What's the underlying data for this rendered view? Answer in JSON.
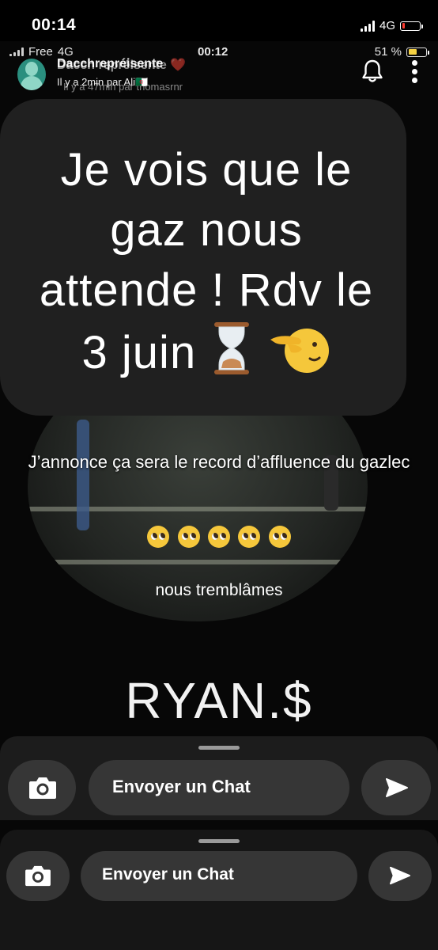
{
  "status": {
    "time": "00:14",
    "network": "4G",
    "battery_color": "#ff3b30",
    "battery_level": 0.15
  },
  "inner_status": {
    "carrier": "Free",
    "network": "4G",
    "time": "00:12",
    "battery": "51 %",
    "battery_color": "#f5d142",
    "battery_level": 0.51
  },
  "header": {
    "title": "Dacchrepréisente",
    "title_overlay": "Dacch repréisente ❤️",
    "subtitle": "Il y a 2min par Ali🇩🇿",
    "subtitle_overlay": "Il y a 47min par thomasrnr",
    "icons": [
      "avatar",
      "bell-icon",
      "more-vertical-icon"
    ]
  },
  "story": {
    "bubble_text": "Je vois que le gaz nous attende ! Rdv le 3 juin",
    "bubble_emojis": [
      "hourglass",
      "pointing-left-face"
    ],
    "caption_1": "J’annonce ça sera le record d’affluence du gazlec",
    "caption_emojis": [
      "🥺",
      "🥺",
      "🥺",
      "🥺",
      "🥺"
    ],
    "caption_2": "nous tremblâmes",
    "signature": "RYAN.$"
  },
  "chat_bar_1": {
    "placeholder": "Envoyer un Chat"
  },
  "chat_bar_2": {
    "placeholder": "Envoyer un Chat"
  }
}
